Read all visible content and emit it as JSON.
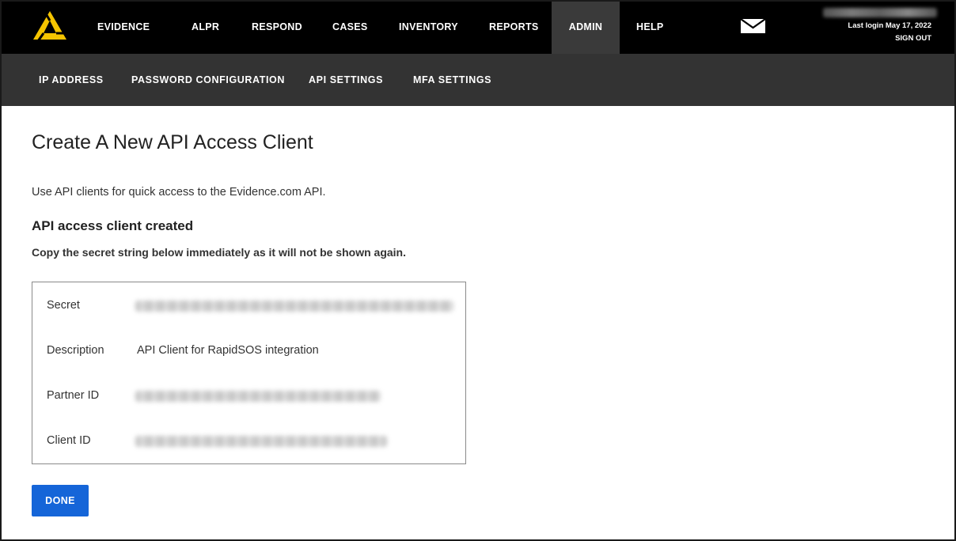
{
  "topnav": {
    "items": [
      {
        "label": "EVIDENCE"
      },
      {
        "label": "ALPR"
      },
      {
        "label": "RESPOND"
      },
      {
        "label": "CASES"
      },
      {
        "label": "INVENTORY"
      },
      {
        "label": "REPORTS"
      },
      {
        "label": "ADMIN",
        "active": true
      },
      {
        "label": "HELP"
      }
    ],
    "last_login": "Last login May 17, 2022",
    "sign_out": "SIGN OUT"
  },
  "subnav": {
    "items": [
      {
        "label": "IP ADDRESS"
      },
      {
        "label": "PASSWORD CONFIGURATION"
      },
      {
        "label": "API SETTINGS"
      },
      {
        "label": "MFA SETTINGS"
      }
    ]
  },
  "main": {
    "title": "Create A New API Access Client",
    "intro": "Use API clients for quick access to the Evidence.com API.",
    "created_heading": "API access client created",
    "warning": "Copy the secret string below immediately as it will not be shown again.",
    "details": {
      "secret_label": "Secret",
      "description_label": "Description",
      "description_value": "API Client for RapidSOS integration",
      "partner_id_label": "Partner ID",
      "client_id_label": "Client ID"
    },
    "done_label": "DONE"
  },
  "colors": {
    "topbar": "#000000",
    "subbar": "#333333",
    "active_tab": "#3a3a3a",
    "logo": "#f5c400",
    "primary_button": "#1565d8"
  },
  "icons": {
    "logo": "axon-triangle-logo",
    "mail": "envelope-icon"
  }
}
